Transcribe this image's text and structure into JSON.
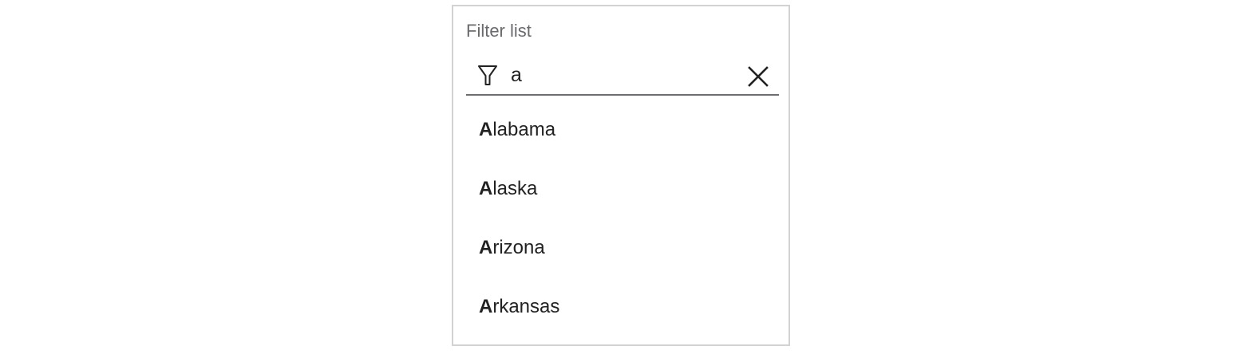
{
  "filter": {
    "label": "Filter list",
    "icon": "filter-icon",
    "query": "a",
    "clear_icon": "close-icon"
  },
  "results": [
    {
      "match": "A",
      "rest": "labama"
    },
    {
      "match": "A",
      "rest": "laska"
    },
    {
      "match": "A",
      "rest": "rizona"
    },
    {
      "match": "A",
      "rest": "rkansas"
    }
  ],
  "colors": {
    "border": "#d2d2d4",
    "label": "#6a6a6f",
    "underline": "#6d6d72",
    "text": "#222222"
  }
}
